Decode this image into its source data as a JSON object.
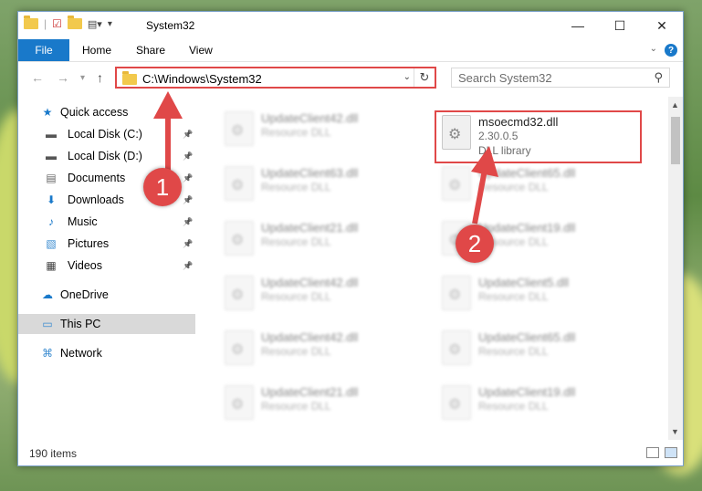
{
  "window": {
    "title": "System32"
  },
  "ribbon": {
    "tabs": [
      "File",
      "Home",
      "Share",
      "View"
    ],
    "help": "?"
  },
  "address": {
    "path": "C:\\Windows\\System32",
    "search_placeholder": "Search System32"
  },
  "nav": [
    {
      "label": "Quick access",
      "icon": "star-icon",
      "pinned": false
    },
    {
      "label": "Local Disk (C:)",
      "icon": "drive-icon",
      "pinned": true
    },
    {
      "label": "Local Disk (D:)",
      "icon": "drive-icon",
      "pinned": true
    },
    {
      "label": "Documents",
      "icon": "documents-icon",
      "pinned": true
    },
    {
      "label": "Downloads",
      "icon": "download-icon",
      "pinned": true
    },
    {
      "label": "Music",
      "icon": "music-icon",
      "pinned": true
    },
    {
      "label": "Pictures",
      "icon": "pictures-icon",
      "pinned": true
    },
    {
      "label": "Videos",
      "icon": "videos-icon",
      "pinned": true
    },
    {
      "label": "OneDrive",
      "icon": "cloud-icon",
      "pinned": false
    },
    {
      "label": "This PC",
      "icon": "pc-icon",
      "pinned": false
    },
    {
      "label": "Network",
      "icon": "network-icon",
      "pinned": false
    }
  ],
  "files": {
    "highlighted": {
      "name": "msoecmd32.dll",
      "line1": "2.30.0.5",
      "line2": "DLL library"
    },
    "left_column": [
      {
        "name": "UpdateClient42.dll",
        "type": "Resource DLL"
      },
      {
        "name": "UpdateClient63.dll",
        "type": "Resource DLL"
      },
      {
        "name": "UpdateClient21.dll",
        "type": "Resource DLL"
      },
      {
        "name": "UpdateClient42.dll",
        "type": "Resource DLL"
      },
      {
        "name": "UpdateClient42.dll",
        "type": "Resource DLL"
      },
      {
        "name": "UpdateClient21.dll",
        "type": "Resource DLL"
      }
    ],
    "right_column": [
      {
        "name": "UpdateClient65.dll",
        "type": "Resource DLL"
      },
      {
        "name": "UpdateClient19.dll",
        "type": "Resource DLL"
      },
      {
        "name": "UpdateClient5.dll",
        "type": "Resource DLL"
      },
      {
        "name": "UpdateClient65.dll",
        "type": "Resource DLL"
      },
      {
        "name": "UpdateClient19.dll",
        "type": "Resource DLL"
      }
    ]
  },
  "status": {
    "count": "190 items"
  },
  "annotations": {
    "step1": "1",
    "step2": "2",
    "color": "#e04848"
  }
}
